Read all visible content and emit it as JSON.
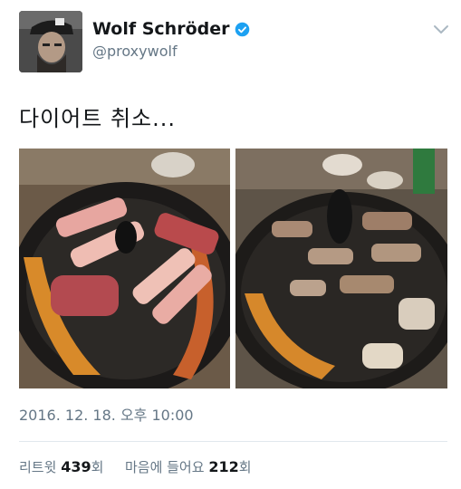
{
  "author": {
    "display_name": "Wolf Schröder",
    "handle": "@proxywolf",
    "verified": true,
    "avatar_icon": "profile-photo-icon"
  },
  "tweet": {
    "text": "다이어트 취소...",
    "photos": [
      {
        "icon": "korean-bbq-photo-raw-icon"
      },
      {
        "icon": "korean-bbq-photo-cooked-icon"
      }
    ],
    "timestamp": "2016. 12. 18. 오후 10:00"
  },
  "stats": {
    "retweets_label_prefix": "리트윗",
    "retweets_count": "439",
    "retweets_label_suffix": "회",
    "likes_label_prefix": "마음에 들어요",
    "likes_count": "212",
    "likes_label_suffix": "회"
  },
  "colors": {
    "text_primary": "#14171a",
    "text_secondary": "#657786",
    "verified_blue": "#1da1f2",
    "divider": "#e1e8ed"
  }
}
